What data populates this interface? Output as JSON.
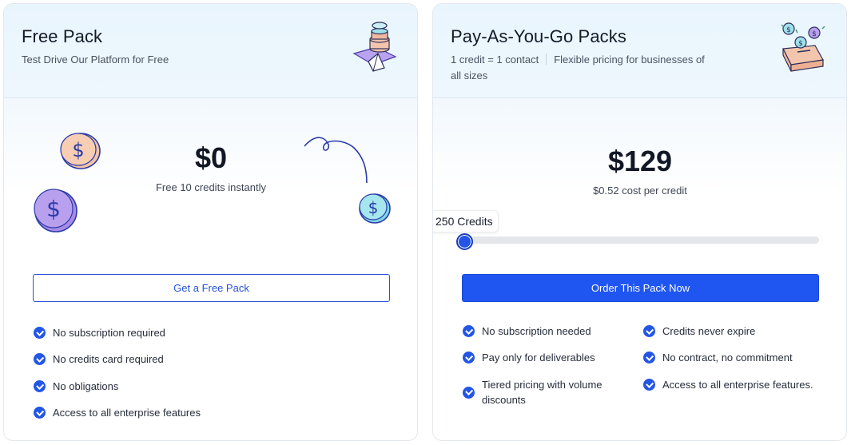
{
  "free_pack": {
    "title": "Free Pack",
    "subtitle": "Test Drive Our Platform for Free",
    "price": "$0",
    "price_note": "Free 10 credits instantly",
    "cta_label": "Get a Free Pack",
    "features": [
      "No subscription required",
      "No credits card required",
      "No obligations",
      "Access to all enterprise features"
    ]
  },
  "payg_pack": {
    "title": "Pay-As-You-Go Packs",
    "subtitle_part1": "1 credit = 1 contact",
    "subtitle_part2": "Flexible pricing for businesses of all sizes",
    "price": "$129",
    "cost_per_credit": "$0.52",
    "cost_per_credit_label": "cost per credit",
    "slider_label": "250 Credits",
    "slider_value": 0,
    "cta_label": "Order This Pack Now",
    "features_left": [
      "No subscription needed",
      "Pay only for deliverables",
      "Tiered pricing with volume discounts"
    ],
    "features_right": [
      "Credits never expire",
      "No contract, no commitment",
      "Access to all enterprise features."
    ]
  },
  "colors": {
    "accent": "#1f55f0",
    "header_bg": "#e9f5fd",
    "check": "#2356e6"
  }
}
